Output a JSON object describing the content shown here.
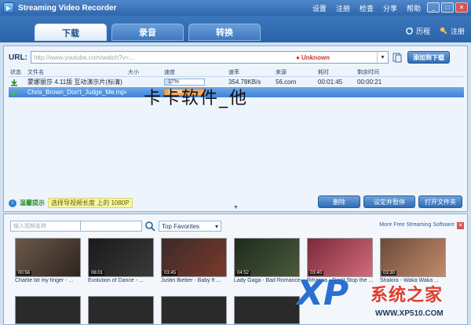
{
  "window": {
    "title": "Streaming Video Recorder"
  },
  "menu": [
    "设置",
    "注册",
    "检查",
    "分享",
    "帮助"
  ],
  "tabs": [
    "下载",
    "录音",
    "转换"
  ],
  "tab_actions": {
    "history": "历程",
    "register": "注册"
  },
  "url_bar": {
    "label": "URL:",
    "value": "http://www.youtube.com/watch?v=...",
    "status": "Unknown",
    "add_button": "添加到下载"
  },
  "table": {
    "headers": [
      "状态",
      "文件名",
      "大小",
      "速度",
      "速率",
      "来源",
      "耗时",
      "剩余时间"
    ],
    "rows": [
      {
        "name": "蒙娜丽莎 4.11版 互动演示片(标清)",
        "size": "",
        "progress_label": "17%",
        "progress": 0.17,
        "rate": "354.78KB/s",
        "source": "56.com",
        "elapsed": "00:01:45",
        "remaining": "00:00:21"
      },
      {
        "name": "Chris_Brown_Don't_Judge_Me.mp4",
        "size": "",
        "progress_label": "100%",
        "progress": 1.0,
        "rate": "",
        "source": "",
        "elapsed": "",
        "remaining": ""
      }
    ]
  },
  "watermark": "卡卡软件_他",
  "tip": {
    "label": "温馨提示",
    "link": "选择导视频长度 上的 1080P"
  },
  "actions": [
    "删除",
    "设定并暂停",
    "打开文件夹"
  ],
  "video_panel": {
    "search_placeholder": "输入视频名称",
    "search_placeholder2": "",
    "favorites": "Top Favorites",
    "more_link": "More Free Streaming Software",
    "videos": [
      {
        "title": "Charlie bit my finger - ...",
        "duration": "00:56"
      },
      {
        "title": "Evolution of Dance - ...",
        "duration": "06:01"
      },
      {
        "title": "Justin Bieber - Baby ft ...",
        "duration": "03:45"
      },
      {
        "title": "Lady Gaga - Bad Romance ...",
        "duration": "04:52"
      },
      {
        "title": "Rihanna - Don't Stop the ...",
        "duration": "03:40"
      },
      {
        "title": "Shakira - Waka Waka ...",
        "duration": "03:30"
      }
    ]
  },
  "brand": {
    "xp": "XP",
    "name": "系统之家",
    "url": "WWW.XP510.COM"
  },
  "colors": {
    "accent": "#2f67ad",
    "progress": "#f4a35a",
    "selected": "#3d83d8"
  }
}
